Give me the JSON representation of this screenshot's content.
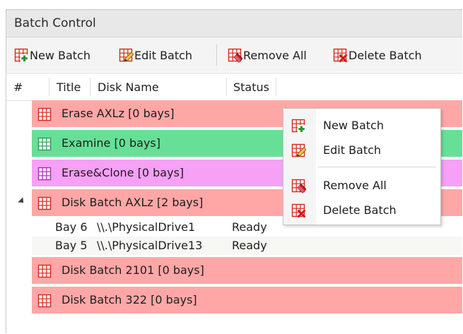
{
  "window": {
    "title": "Batch Control"
  },
  "toolbar": {
    "new_batch": "New Batch",
    "edit_batch": "Edit Batch",
    "remove_all": "Remove All",
    "delete_batch": "Delete Batch"
  },
  "columns": {
    "num": "#",
    "title": "Title",
    "disk_name": "Disk Name",
    "status": "Status"
  },
  "batches": [
    {
      "label": "Erase AXLz [0 bays]",
      "color": "#ffa7a7"
    },
    {
      "label": "Examine [0 bays]",
      "color": "#67df96"
    },
    {
      "label": "Erase&Clone [0 bays]",
      "color": "#f6a0f6"
    },
    {
      "label": "Disk Batch AXLz [2 bays]",
      "color": "#ffa7a7"
    },
    {
      "label": "Disk Batch 2101 [0 bays]",
      "color": "#ffa7a7"
    },
    {
      "label": "Disk Batch 322 [0 bays]",
      "color": "#ffa7a7"
    }
  ],
  "bays": [
    {
      "title": "Bay 6",
      "disk": "\\\\.\\PhysicalDrive1",
      "status": "Ready"
    },
    {
      "title": "Bay 5",
      "disk": "\\\\.\\PhysicalDrive13",
      "status": "Ready"
    }
  ],
  "context_menu": {
    "new_batch": "New Batch",
    "edit_batch": "Edit Batch",
    "remove_all": "Remove All",
    "delete_batch": "Delete Batch"
  },
  "icons": {
    "batch": "grid-icon",
    "new": "grid-plus-icon",
    "edit": "grid-pencil-icon",
    "remove_all": "grid-eraser-icon",
    "delete": "grid-x-icon"
  }
}
